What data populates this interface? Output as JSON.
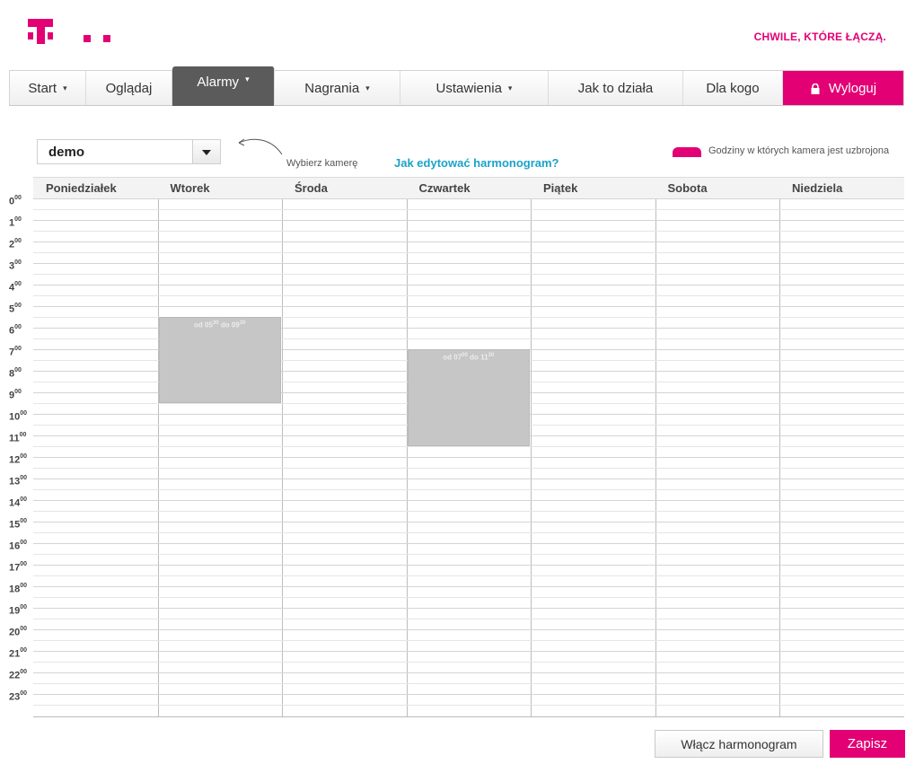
{
  "header": {
    "slogan": "CHWILE, KTÓRE ŁĄCZĄ.",
    "brand_color": "#e20074"
  },
  "nav": {
    "items": [
      {
        "label": "Start",
        "has_dropdown": true
      },
      {
        "label": "Oglądaj",
        "has_dropdown": false
      },
      {
        "label": "Alarmy",
        "has_dropdown": true,
        "active": true
      },
      {
        "label": "Nagrania",
        "has_dropdown": true
      },
      {
        "label": "Ustawienia",
        "has_dropdown": true
      },
      {
        "label": "Jak to działa",
        "has_dropdown": false
      },
      {
        "label": "Dla kogo",
        "has_dropdown": false
      }
    ],
    "logout_label": "Wyloguj",
    "caret": "▾"
  },
  "toolbar": {
    "camera_value": "demo",
    "choose_camera_label": "Wybierz kamerę",
    "howto_link": "Jak edytować harmonogram?",
    "legend_text": "Godziny w których kamera jest uzbrojona"
  },
  "calendar": {
    "days": [
      "Poniedziałek",
      "Wtorek",
      "Środa",
      "Czwartek",
      "Piątek",
      "Sobota",
      "Niedziela"
    ],
    "hours": [
      "0",
      "1",
      "2",
      "3",
      "4",
      "5",
      "6",
      "7",
      "8",
      "9",
      "10",
      "11",
      "12",
      "13",
      "14",
      "15",
      "16",
      "17",
      "18",
      "19",
      "20",
      "21",
      "22",
      "23"
    ],
    "hour_suffix": "00",
    "blocks": [
      {
        "day": 1,
        "start_hour": 5.5,
        "end_hour": 9.5,
        "label_od": "od 05",
        "label_od_sup": "30",
        "label_do": " do 09",
        "label_do_sup": "30"
      },
      {
        "day": 3,
        "start_hour": 7.0,
        "end_hour": 11.5,
        "label_od": "od 07",
        "label_od_sup": "00",
        "label_do": " do 11",
        "label_do_sup": "30"
      }
    ]
  },
  "buttons": {
    "enable_schedule": "Włącz harmonogram",
    "save": "Zapisz"
  }
}
